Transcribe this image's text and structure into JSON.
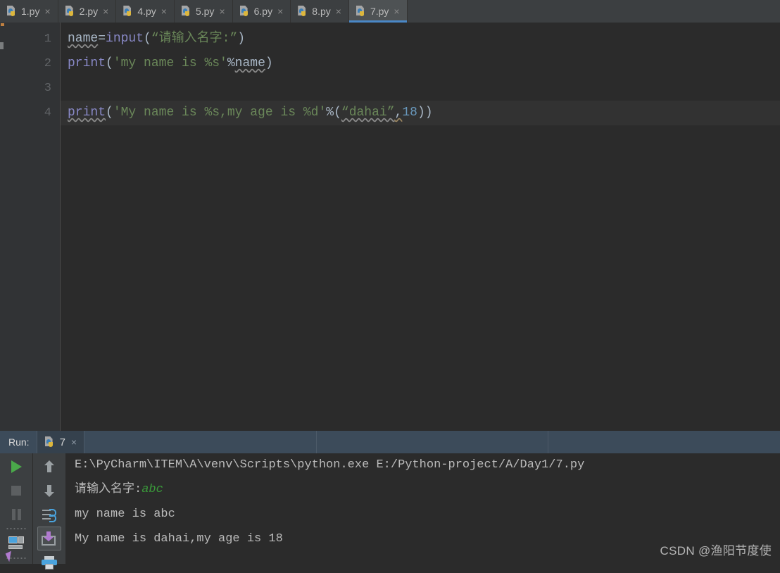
{
  "window": {
    "app": "PyCharm",
    "theme_bg": "#2b2b2b",
    "accent": "#4a88c7"
  },
  "tabbar": {
    "close_glyph": "×",
    "tabs": [
      {
        "label": "1.py",
        "icon": "python-file-icon",
        "active": false
      },
      {
        "label": "2.py",
        "icon": "python-file-icon",
        "active": false
      },
      {
        "label": "4.py",
        "icon": "python-file-icon",
        "active": false
      },
      {
        "label": "5.py",
        "icon": "python-file-icon",
        "active": false
      },
      {
        "label": "6.py",
        "icon": "python-file-icon",
        "active": false
      },
      {
        "label": "8.py",
        "icon": "python-file-icon",
        "active": false
      },
      {
        "label": "7.py",
        "icon": "python-file-icon",
        "active": true
      }
    ]
  },
  "editor": {
    "line_numbers": [
      "1",
      "2",
      "3",
      "4"
    ],
    "current_line": 4,
    "lines": [
      {
        "number": "1",
        "tokens": [
          {
            "text": "name",
            "style": "plain",
            "underline": "wavy"
          },
          {
            "text": "=",
            "style": "punct"
          },
          {
            "text": "input",
            "style": "builtin"
          },
          {
            "text": "(",
            "style": "punct"
          },
          {
            "text": "“请输入名字:”",
            "style": "str"
          },
          {
            "text": ")",
            "style": "punct"
          }
        ]
      },
      {
        "number": "2",
        "tokens": [
          {
            "text": "print",
            "style": "builtin"
          },
          {
            "text": "(",
            "style": "punct"
          },
          {
            "text": "'my name is %s'",
            "style": "str"
          },
          {
            "text": "%",
            "style": "punct"
          },
          {
            "text": "name",
            "style": "plain",
            "underline": "wavy"
          },
          {
            "text": ")",
            "style": "punct"
          }
        ]
      },
      {
        "number": "3",
        "tokens": []
      },
      {
        "number": "4",
        "tokens": [
          {
            "text": "print",
            "style": "builtin",
            "underline": "wavy"
          },
          {
            "text": "(",
            "style": "punct"
          },
          {
            "text": "'My name is %s,my age is %d'",
            "style": "str"
          },
          {
            "text": "%",
            "style": "punct"
          },
          {
            "text": "(",
            "style": "punct"
          },
          {
            "text": "“dahai”",
            "style": "str",
            "underline": "wavy"
          },
          {
            "text": ",",
            "style": "punct",
            "underline": "wavy-warn"
          },
          {
            "text": "18",
            "style": "num"
          },
          {
            "text": "))",
            "style": "punct"
          }
        ]
      }
    ],
    "plain_text": [
      "name=input(“请输入名字:”)",
      "print('my name is %s'%name)",
      "",
      "print('My name is %s,my age is %d'%(“dahai”,18))"
    ]
  },
  "run_panel": {
    "label": "Run:",
    "tab": {
      "label": "7",
      "icon": "python-file-icon",
      "close_glyph": "×"
    },
    "toolbar_left": [
      {
        "name": "rerun-button",
        "icon": "play-icon"
      },
      {
        "name": "stop-button",
        "icon": "stop-icon"
      },
      {
        "name": "pause-button",
        "icon": "pause-icon"
      },
      {
        "name": "show-console-button",
        "icon": "console-icon"
      }
    ],
    "toolbar_right": [
      {
        "name": "up-button",
        "icon": "arrow-up-icon"
      },
      {
        "name": "down-button",
        "icon": "arrow-down-icon"
      },
      {
        "name": "soft-wrap-button",
        "icon": "soft-wrap-icon"
      },
      {
        "name": "scroll-to-end-button",
        "icon": "scroll-to-end-icon",
        "selected": true
      },
      {
        "name": "print-button",
        "icon": "print-icon"
      }
    ],
    "console": {
      "lines": [
        {
          "text": "E:\\PyCharm\\ITEM\\A\\venv\\Scripts\\python.exe E:/Python-project/A/Day1/7.py",
          "kind": "command"
        },
        {
          "prompt": "请输入名字:",
          "input": "abc",
          "kind": "prompt-with-input"
        },
        {
          "text": "my name is abc",
          "kind": "output"
        },
        {
          "text": "My name is dahai,my age is 18",
          "kind": "output"
        }
      ]
    }
  },
  "watermark": {
    "text": "CSDN @渔阳节度使"
  }
}
